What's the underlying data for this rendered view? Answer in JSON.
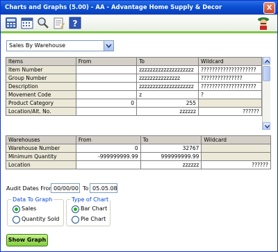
{
  "window": {
    "title": "Charts and Graphs (5.00) - AA - Advantage Home Supply & Decor",
    "close_label": "X"
  },
  "toolbar": {
    "icons": [
      "calculator-icon",
      "calendar-icon",
      "magnifier-icon",
      "notes-icon",
      "help-icon"
    ],
    "help_label": "?"
  },
  "report_select": {
    "selected": "Sales By Warehouse"
  },
  "items_table": {
    "headers": [
      "Items",
      "From",
      "To",
      "Wildcard"
    ],
    "rows": [
      {
        "label": "Item Number",
        "from": "",
        "to": "zzzzzzzzzzzzzzzzzzzz",
        "wildcard": "????????????????????"
      },
      {
        "label": "Group Number",
        "from": "",
        "to": "zzzzzzzzzzzzzzz",
        "wildcard": "???????????????"
      },
      {
        "label": "Description",
        "from": "",
        "to": "zzzzzzzzzzzzzzzzzzzz",
        "wildcard": "????????????????????"
      },
      {
        "label": "Movement Code",
        "from": "",
        "to": "z",
        "wildcard": "?"
      },
      {
        "label": "Product Category",
        "from": "0",
        "to": "255",
        "wildcard": ""
      },
      {
        "label": "Location/Alt. No.",
        "from": "",
        "to": "zzzzzz",
        "wildcard": "??????"
      }
    ]
  },
  "warehouses_table": {
    "headers": [
      "Warehouses",
      "From",
      "To",
      "Wildcard"
    ],
    "rows": [
      {
        "label": "Warehouse Number",
        "from": "0",
        "to": "32767",
        "wildcard": ""
      },
      {
        "label": "Minimum Quantity",
        "from": "-999999999.99",
        "to": "999999999.99",
        "wildcard": ""
      },
      {
        "label": "Location",
        "from": "",
        "to": "zzzzzz",
        "wildcard": "??????"
      }
    ]
  },
  "audit": {
    "label": "Audit Dates From",
    "from": "00/00/00",
    "to_label": "To",
    "to": "05.05.08"
  },
  "data_to_graph": {
    "title": "Data To Graph",
    "options": [
      "Sales",
      "Quantity Sold"
    ],
    "selected": "Sales"
  },
  "chart_type": {
    "title": "Type of Chart",
    "options": [
      "Bar Chart",
      "Pie Chart"
    ],
    "selected": "Bar Chart"
  },
  "show_graph_label": "Show Graph"
}
